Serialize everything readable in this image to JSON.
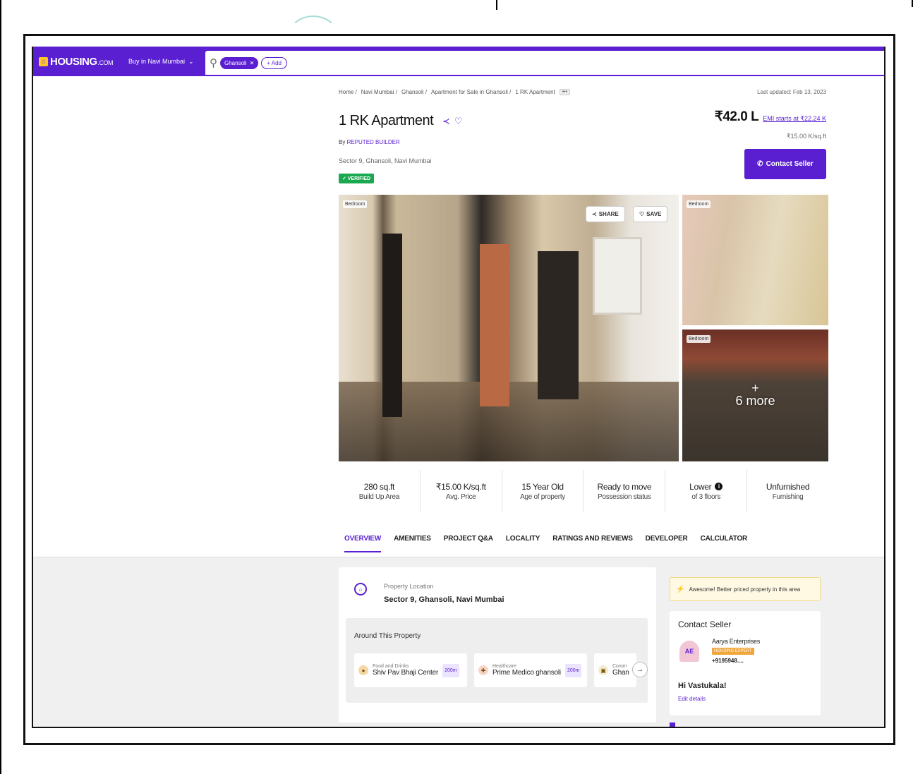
{
  "nav": {
    "logo_text": "HOUSING",
    "logo_suffix": ".COM",
    "logo_icon": "house-icon",
    "buy_dropdown": "Buy in Navi Mumbai",
    "search_chip": "Ghansoli",
    "add_chip": "+ Add"
  },
  "breadcrumb": {
    "items": [
      "Home",
      "Navi Mumbai",
      "Ghansoli",
      "Apartment for Sale in Ghansoli",
      "1 RK Apartment"
    ],
    "more": "•••"
  },
  "last_updated": "Last updated: Feb 13, 2023",
  "property": {
    "title": "1 RK Apartment",
    "by_prefix": "By",
    "builder": "REPUTED BUILDER",
    "address": "Sector 9, Ghansoli, Navi Mumbai",
    "verified": "✓ VERIFIED",
    "price": "₹42.0 L",
    "emi": "EMI starts at ₹22.24 K",
    "per_sqft": "₹15.00 K/sq.ft",
    "contact_button": "Contact Seller"
  },
  "gallery": {
    "main_tag": "Bedroom",
    "share_label": "SHARE",
    "save_label": "SAVE",
    "side1_tag": "Bedroom",
    "side2_tag": "Bedroom",
    "more_plus": "+",
    "more_label": "6 more"
  },
  "facts": [
    {
      "value": "280 sq.ft",
      "label": "Build Up Area"
    },
    {
      "value": "₹15.00 K/sq.ft",
      "label": "Avg. Price"
    },
    {
      "value": "15 Year Old",
      "label": "Age of property"
    },
    {
      "value": "Ready to move",
      "label": "Possession status"
    },
    {
      "value": "Lower",
      "label": "of 3 floors",
      "info": "i"
    },
    {
      "value": "Unfurnished",
      "label": "Furnishing"
    }
  ],
  "tabs": [
    "OVERVIEW",
    "AMENITIES",
    "PROJECT Q&A",
    "LOCALITY",
    "RATINGS AND REVIEWS",
    "DEVELOPER",
    "CALCULATOR"
  ],
  "location": {
    "label": "Property Location",
    "value": "Sector 9, Ghansoli, Navi Mumbai",
    "around_title": "Around This Property",
    "pois": [
      {
        "category": "Food and Drinks",
        "name": "Shiv Pav Bhaji Center",
        "distance": "200m"
      },
      {
        "category": "Healthcare",
        "name": "Prime Medico ghansoli",
        "distance": "200m"
      },
      {
        "category": "Comm",
        "name": "Ghan",
        "distance": ""
      }
    ]
  },
  "awesome_banner": "Awesome! Better priced property in this area",
  "seller": {
    "title": "Contact Seller",
    "name": "Aarya Enterprises",
    "badge": "HOUSING EXPERT",
    "phone": "+9195948....",
    "avatar_text": "AE",
    "greeting": "Hi Vastukala!",
    "edit": "Edit details"
  },
  "colors": {
    "brand": "#5a1fd1",
    "verified": "#1aa851",
    "highlight": "#f4b400"
  }
}
